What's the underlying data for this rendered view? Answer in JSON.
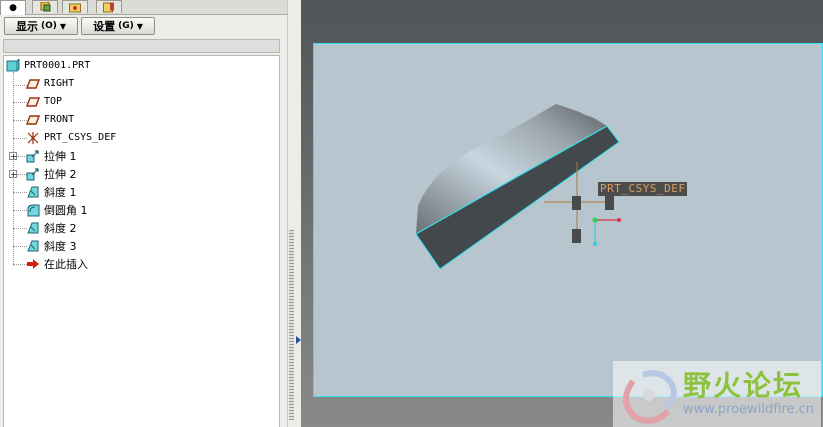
{
  "left_panel": {
    "tabs": [
      {
        "icon": "model-tree-icon"
      },
      {
        "icon": "layer-icon"
      },
      {
        "icon": "folder-favorites-icon"
      }
    ],
    "buttons": {
      "display_label": "显示",
      "display_shortcut": "(O)",
      "settings_label": "设置",
      "settings_shortcut": "(G)"
    },
    "tree": {
      "root": "PRT0001.PRT",
      "items": [
        {
          "label": "RIGHT",
          "icon": "datum-plane-icon"
        },
        {
          "label": "TOP",
          "icon": "datum-plane-icon"
        },
        {
          "label": "FRONT",
          "icon": "datum-plane-icon"
        },
        {
          "label": "PRT_CSYS_DEF",
          "icon": "coordinate-system-icon"
        },
        {
          "label": "拉伸 1",
          "icon": "extrude-icon",
          "expandable": true
        },
        {
          "label": "拉伸 2",
          "icon": "extrude-icon",
          "expandable": true
        },
        {
          "label": "斜度 1",
          "icon": "draft-icon"
        },
        {
          "label": "倒圆角 1",
          "icon": "round-icon"
        },
        {
          "label": "斜度 2",
          "icon": "draft-icon"
        },
        {
          "label": "斜度 3",
          "icon": "draft-icon"
        },
        {
          "label": "在此插入",
          "icon": "insert-here-arrow-icon"
        }
      ]
    }
  },
  "graphics": {
    "csys_label": "PRT_CSYS_DEF",
    "background_color": "#b7c5cf",
    "edge_highlight_color": "#33e0ee",
    "watermark": {
      "title": "野火论坛",
      "url": "www.proewildfire.cn"
    }
  }
}
